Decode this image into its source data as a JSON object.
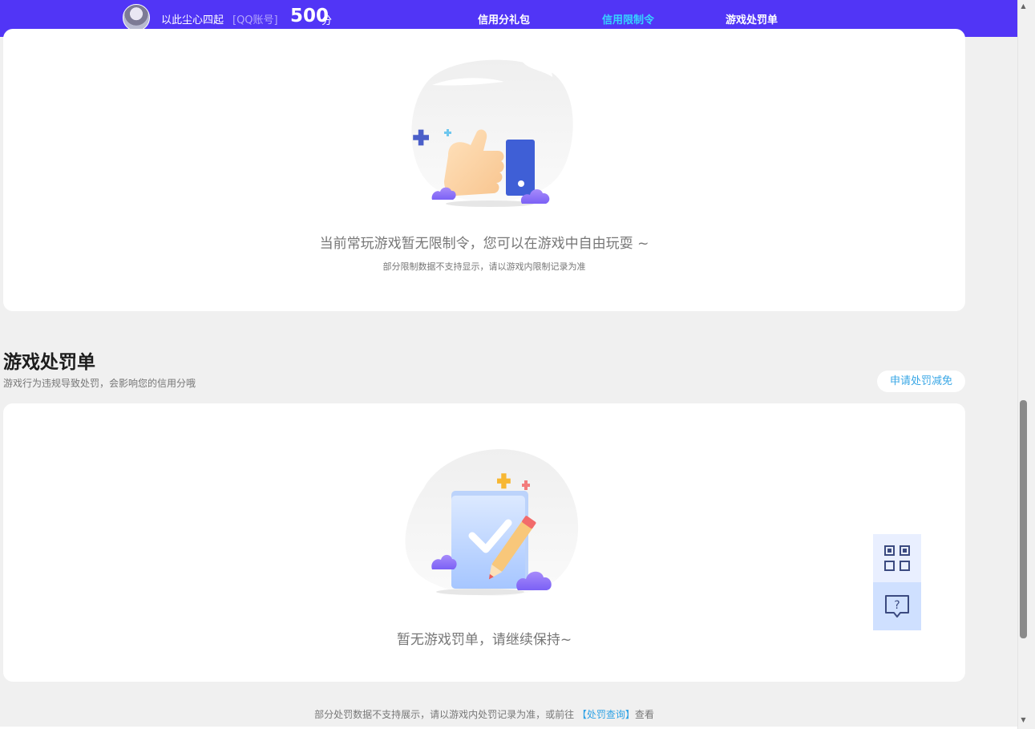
{
  "header": {
    "username": "以此尘心四起",
    "account_type": "[QQ账号]",
    "score": "500",
    "score_unit": "分",
    "tabs": [
      {
        "label": "信用分礼包",
        "active": false
      },
      {
        "label": "信用限制令",
        "active": true
      },
      {
        "label": "游戏处罚单",
        "active": false
      }
    ],
    "accent_color": "#5135f6",
    "active_tab_color": "#36d3ff"
  },
  "restriction_card": {
    "icon": "thumbs-up-illustration",
    "message": "当前常玩游戏暂无限制令，您可以在游戏中自由玩耍 ~",
    "note": "部分限制数据不支持显示，请以游戏内限制记录为准"
  },
  "penalty_section": {
    "title": "游戏处罚单",
    "description": "游戏行为违规导致处罚，会影响您的信用分哦",
    "apply_button": "申请处罚减免",
    "icon": "checklist-pencil-illustration",
    "message": "暂无游戏罚单，请继续保持~"
  },
  "footer": {
    "note_prefix": "部分处罚数据不支持展示，请以游戏内处罚记录为准，或前往 ",
    "link_text": "【处罚查询】",
    "note_suffix": "查看"
  },
  "floating": {
    "qr_icon": "qr-code-icon",
    "help_icon": "help-chat-icon"
  }
}
